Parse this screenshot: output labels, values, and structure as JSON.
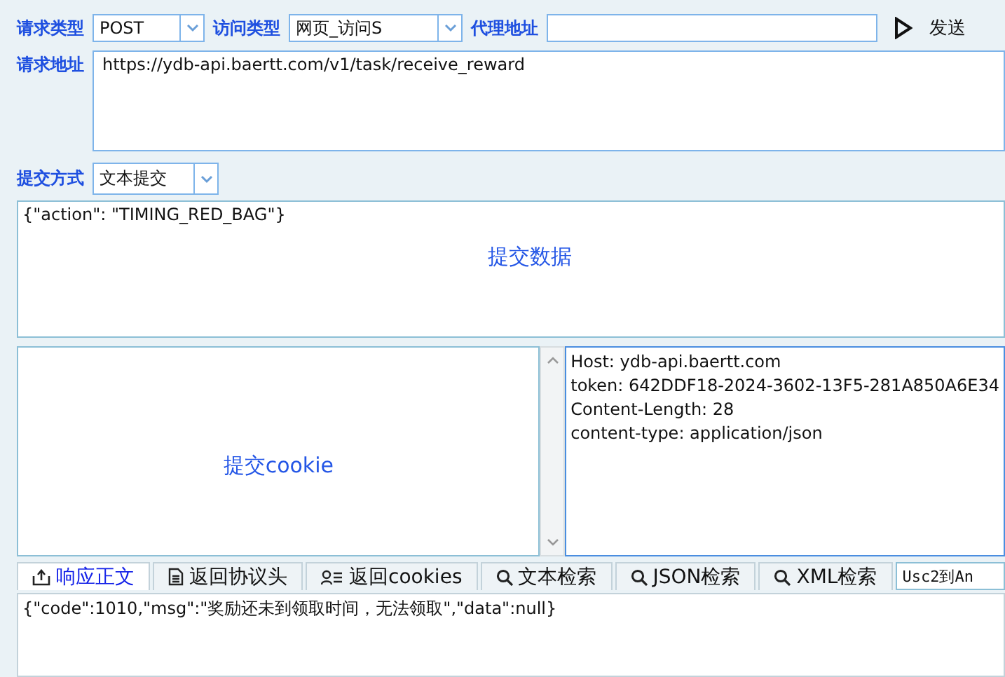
{
  "request": {
    "method_label": "请求类型",
    "method": "POST",
    "access_label": "访问类型",
    "access": "网页_访问S",
    "proxy_label": "代理地址",
    "send": "发送",
    "url_label": "请求地址",
    "url": "https://ydb-api.baertt.com/v1/task/receive_reward"
  },
  "submit": {
    "mode_label": "提交方式",
    "mode": "文本提交",
    "data": "{\"action\": \"TIMING_RED_BAG\"}",
    "data_hint": "提交数据",
    "cookie_hint": "提交cookie"
  },
  "headers": [
    "Host: ydb-api.baertt.com",
    "token: 642DDF18-2024-3602-13F5-281A850A6E34",
    "Content-Length: 28",
    "content-type: application/json"
  ],
  "tabs": [
    {
      "label": "响应正文",
      "kind": "upload",
      "selected": true
    },
    {
      "label": "返回协议头",
      "kind": "document",
      "selected": false
    },
    {
      "label": "返回cookies",
      "kind": "person",
      "selected": false
    },
    {
      "label": "文本检索",
      "kind": "search",
      "selected": false
    },
    {
      "label": "JSON检索",
      "kind": "search",
      "selected": false
    },
    {
      "label": "XML检索",
      "kind": "search",
      "selected": false
    }
  ],
  "convert": "Usc2到An",
  "response": "{\"code\":1010,\"msg\":\"奖励还未到领取时间，无法领取\",\"data\":null}"
}
